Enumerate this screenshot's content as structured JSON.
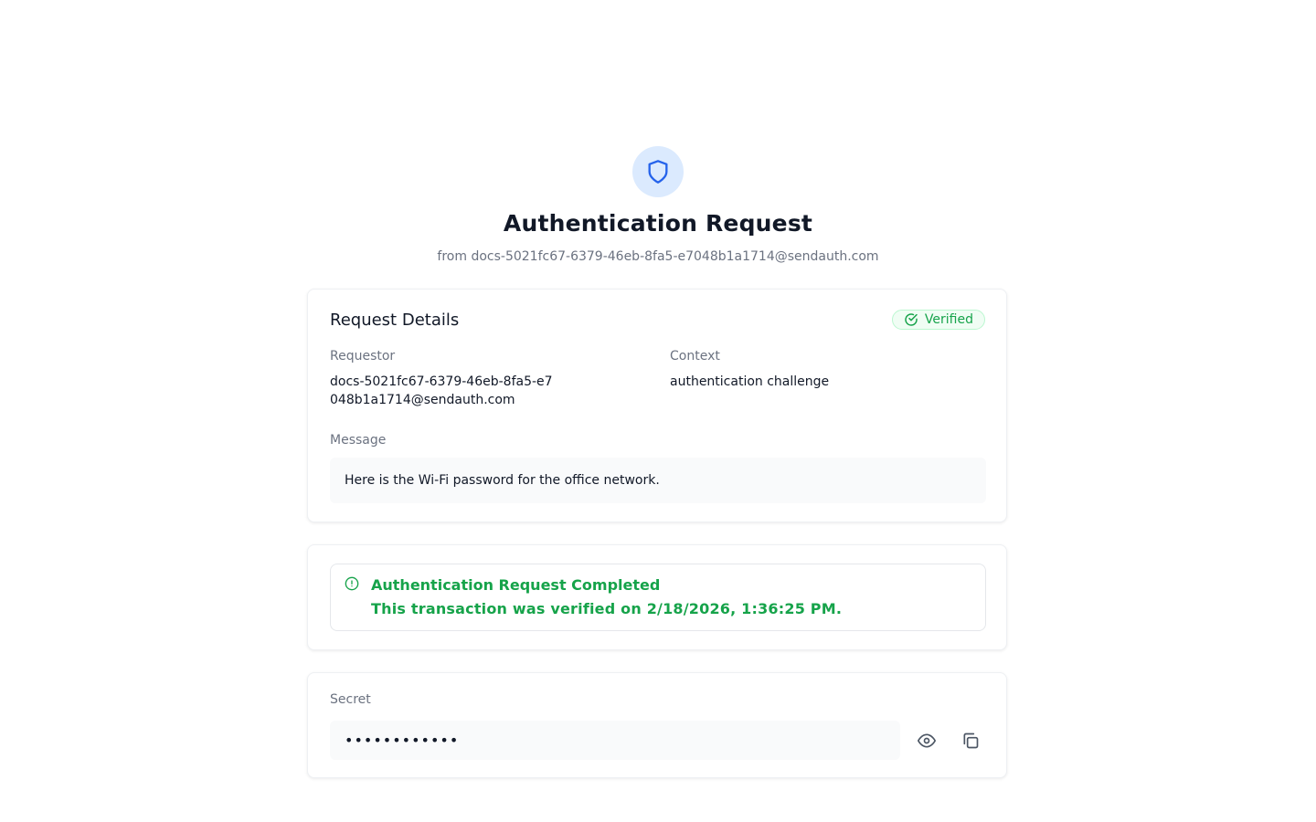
{
  "header": {
    "title": "Authentication Request",
    "subtitle": "from docs-5021fc67-6379-46eb-8fa5-e7048b1a1714@sendauth.com",
    "icon": "shield-icon"
  },
  "details": {
    "heading": "Request Details",
    "badge_label": "Verified",
    "requestor_label": "Requestor",
    "requestor_value": "docs-5021fc67-6379-46eb-8fa5-e7048b1a1714@sendauth.com",
    "context_label": "Context",
    "context_value": "authentication challenge",
    "message_label": "Message",
    "message_value": "Here is the Wi-Fi password for the office network."
  },
  "status": {
    "title": "Authentication Request Completed",
    "text": "This transaction was verified on 2/18/2026, 1:36:25 PM.",
    "icon": "alert-circle-icon"
  },
  "secret": {
    "label": "Secret",
    "masked_value": "••••••••••••",
    "reveal_icon": "eye-icon",
    "copy_icon": "copy-icon"
  },
  "colors": {
    "accent_blue": "#2563eb",
    "shield_bg": "#dbeafe",
    "success_green": "#16a34a",
    "muted_text": "#6b7280"
  }
}
